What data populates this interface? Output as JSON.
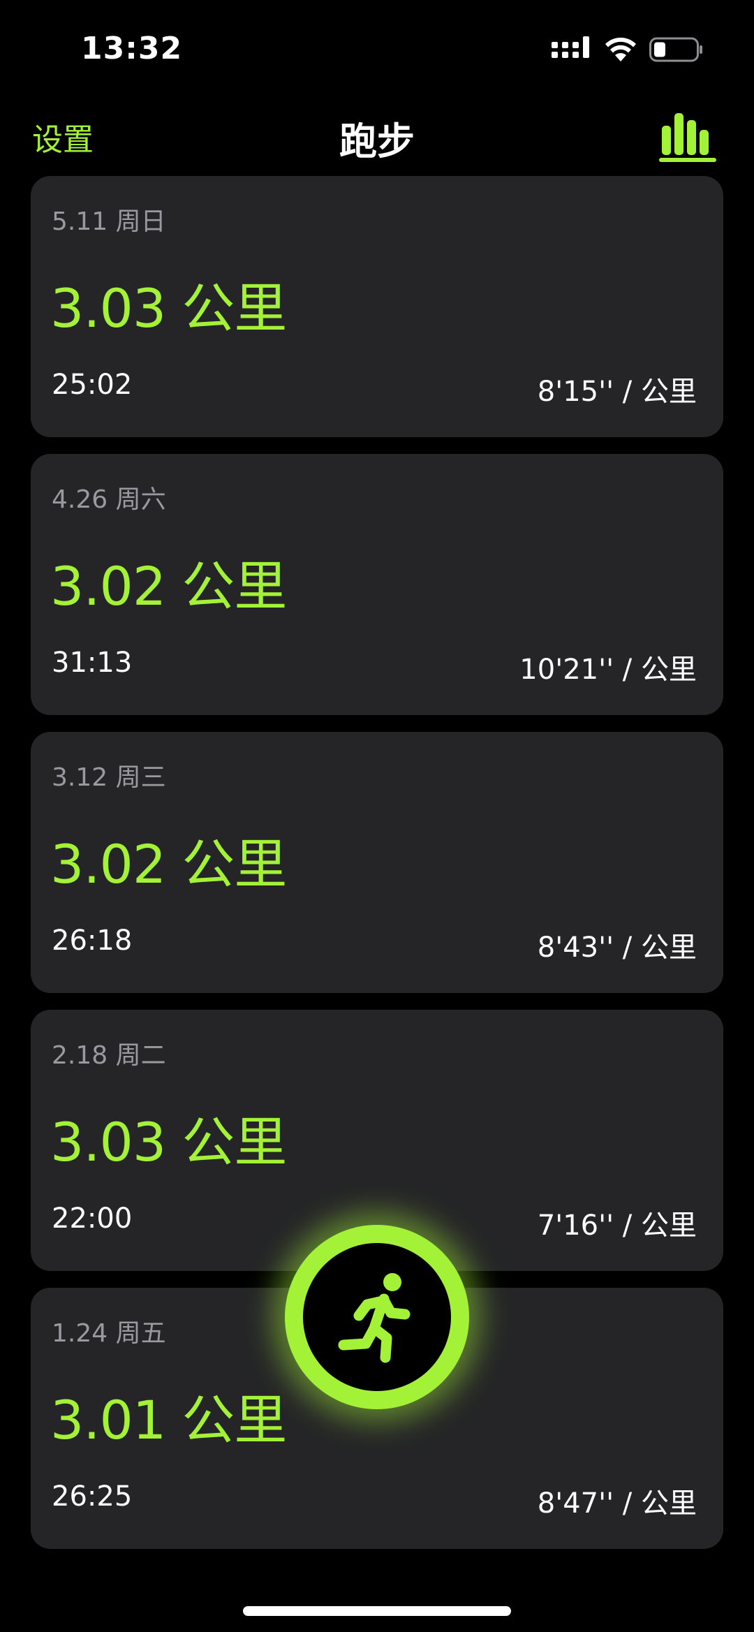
{
  "status_bar": {
    "time": "13:32",
    "icons": [
      "signal-icon",
      "wifi-icon",
      "battery-icon"
    ]
  },
  "nav": {
    "settings_label": "设置",
    "title": "跑步",
    "stats_icon": "bar-chart-icon"
  },
  "workouts": [
    {
      "date": "5.11 周日",
      "distance": "3.03 公里",
      "duration": "25:02",
      "pace": "8'15'' / 公里"
    },
    {
      "date": "4.26 周六",
      "distance": "3.02 公里",
      "duration": "31:13",
      "pace": "10'21'' / 公里"
    },
    {
      "date": "3.12 周三",
      "distance": "3.02 公里",
      "duration": "26:18",
      "pace": "8'43'' / 公里"
    },
    {
      "date": "2.18 周二",
      "distance": "3.03 公里",
      "duration": "22:00",
      "pace": "7'16'' / 公里"
    },
    {
      "date": "1.24 周五",
      "distance": "3.01 公里",
      "duration": "26:25",
      "pace": "8'47'' / 公里"
    }
  ],
  "start_button": {
    "icon": "runner-icon"
  },
  "colors": {
    "accent": "#a4f237",
    "background": "#000000",
    "card": "#252527",
    "secondary_text": "#9a9a9e"
  }
}
